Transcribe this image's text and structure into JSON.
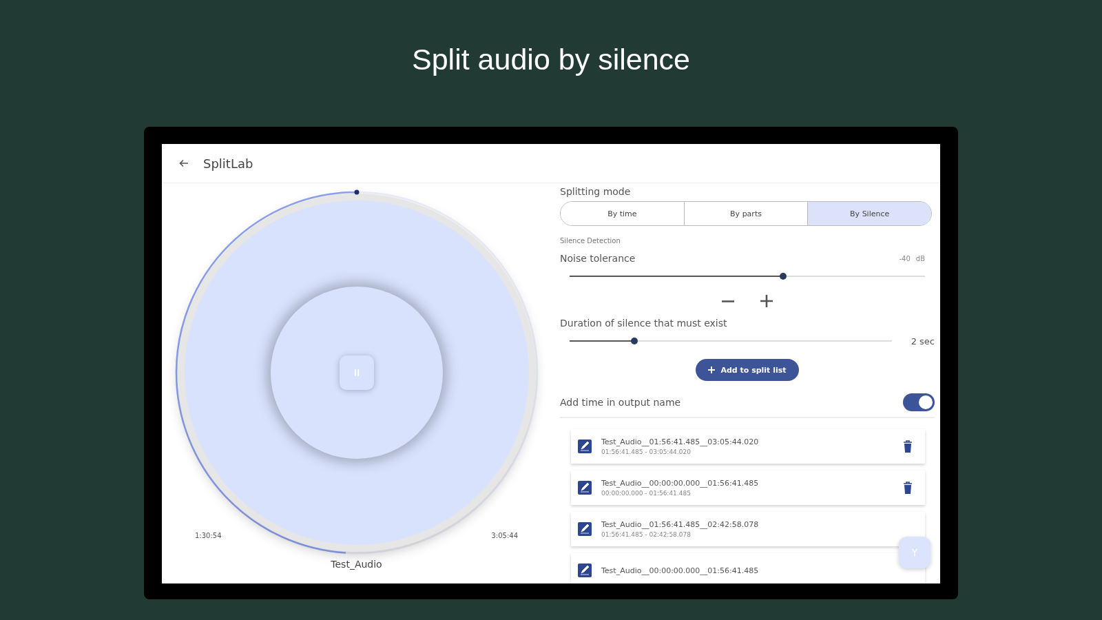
{
  "headline": "Split audio by silence",
  "app_bar": {
    "title": "SplitLab"
  },
  "player": {
    "level": 0.49,
    "elapsed": "1:30:54",
    "total": "3:05:44",
    "file_name": "Test_Audio",
    "playing": true
  },
  "splitting_mode": {
    "label": "Splitting mode",
    "tabs": [
      {
        "label": "By time",
        "selected": false
      },
      {
        "label": "By parts",
        "selected": false
      },
      {
        "label": "By Silence",
        "selected": true
      }
    ]
  },
  "silence_detection": {
    "heading": "Silence Detection",
    "noise_tolerance": {
      "label": "Noise tolerance",
      "value": "-40",
      "unit": "dB",
      "level": 0.6
    },
    "duration": {
      "label": "Duration of silence that must exist",
      "reading": "2 sec",
      "level": 0.2
    }
  },
  "add_button": "Add to split list",
  "add_time_toggle": {
    "label": "Add time in output name",
    "on": true
  },
  "split_list": [
    {
      "name": "Test_Audio__01:56:41.485__03:05:44.020",
      "range": "01:56:41.485 - 03:05:44.020",
      "delete_icon": true
    },
    {
      "name": "Test_Audio__00:00:00.000__01:56:41.485",
      "range": "00:00:00.000 - 01:56:41.485",
      "delete_icon": true
    },
    {
      "name": "Test_Audio__01:56:41.485__02:42:58.078",
      "range": "01:56:41.485 - 02:42:58.078",
      "delete_icon": false
    },
    {
      "name": "Test_Audio__00:00:00.000__01:56:41.485",
      "delete_icon": false
    }
  ]
}
